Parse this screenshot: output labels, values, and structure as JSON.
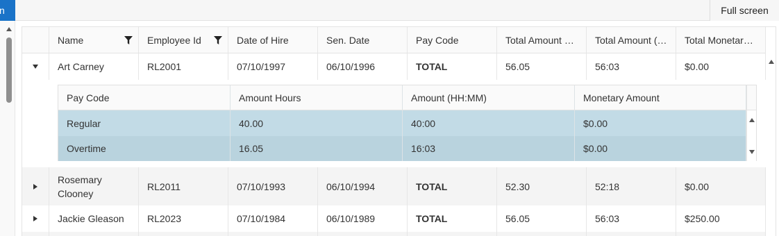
{
  "toolbar": {
    "blue_tab_label": "n",
    "fullscreen_label": "Full screen"
  },
  "grid": {
    "columns": [
      "Name",
      "Employee Id",
      "Date of Hire",
      "Sen. Date",
      "Pay Code",
      "Total Amount …",
      "Total Amount (…",
      "Total Monetar…"
    ],
    "rows": [
      {
        "name": "Art Carney",
        "employee_id": "RL2001",
        "date_of_hire": "07/10/1997",
        "sen_date": "06/10/1996",
        "pay_code": "TOTAL",
        "total_amount_hours": "56.05",
        "total_amount_hhmm": "56:03",
        "total_monetary": "$0.00",
        "expanded": true
      },
      {
        "name": "Rosemary Clooney",
        "employee_id": "RL2011",
        "date_of_hire": "07/10/1993",
        "sen_date": "06/10/1994",
        "pay_code": "TOTAL",
        "total_amount_hours": "52.30",
        "total_amount_hhmm": "52:18",
        "total_monetary": "$0.00",
        "expanded": false
      },
      {
        "name": "Jackie Gleason",
        "employee_id": "RL2023",
        "date_of_hire": "07/10/1984",
        "sen_date": "06/10/1989",
        "pay_code": "TOTAL",
        "total_amount_hours": "56.05",
        "total_amount_hhmm": "56:03",
        "total_monetary": "$250.00",
        "expanded": false
      }
    ]
  },
  "detail": {
    "columns": [
      "Pay Code",
      "Amount Hours",
      "Amount (HH:MM)",
      "Monetary Amount"
    ],
    "rows": [
      {
        "pay_code": "Regular",
        "amount_hours": "40.00",
        "amount_hhmm": "40:00",
        "monetary_amount": "$0.00"
      },
      {
        "pay_code": "Overtime",
        "amount_hours": "16.05",
        "amount_hhmm": "16:03",
        "monetary_amount": "$0.00"
      }
    ]
  },
  "icons": {
    "filter": "filter-icon",
    "expand": "chevron-right-icon",
    "collapse": "chevron-down-icon"
  },
  "colors": {
    "accent": "#1a73c8",
    "selected_row": "#c2dbe6",
    "selected_row_alt": "#b9d3de"
  }
}
